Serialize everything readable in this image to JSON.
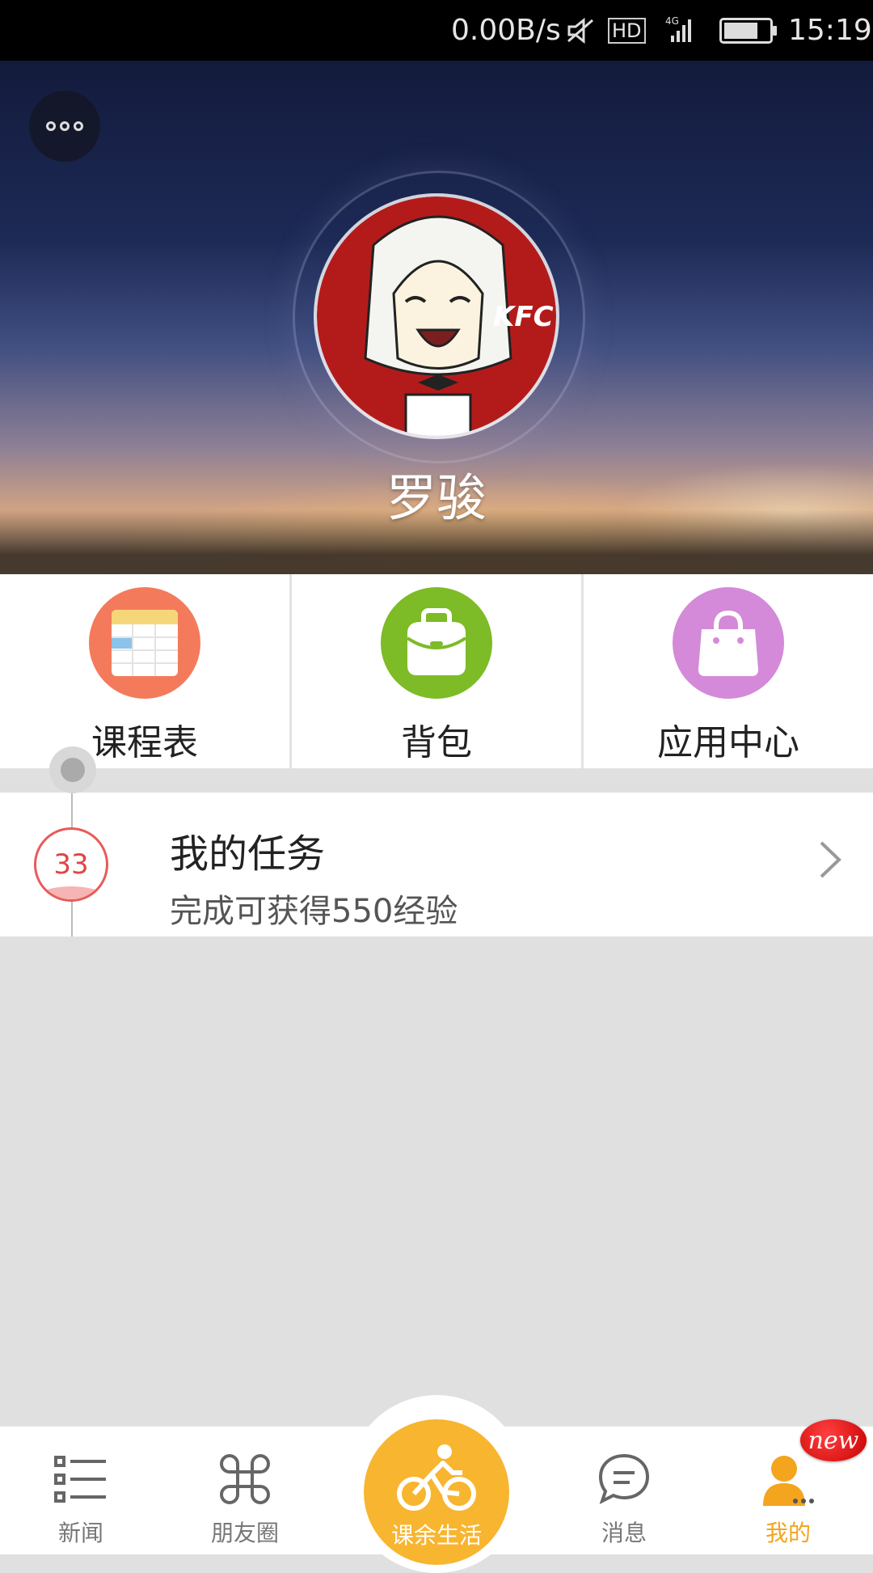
{
  "status_bar": {
    "network_speed": "0.00B/s",
    "hd_label": "HD",
    "network_type": "4G",
    "time": "15:19"
  },
  "profile": {
    "name": "罗骏",
    "avatar_text": "KFC"
  },
  "quick_menu": [
    {
      "label": "课程表",
      "color": "#f47a5c",
      "icon": "calendar-icon"
    },
    {
      "label": "背包",
      "color": "#7dbb27",
      "icon": "backpack-icon"
    },
    {
      "label": "应用中心",
      "color": "#d48ad8",
      "icon": "shopping-bag-icon"
    }
  ],
  "task": {
    "level": "33",
    "title": "我的任务",
    "subtitle": "完成可获得550经验"
  },
  "bottom_nav": {
    "items": [
      {
        "label": "新闻",
        "icon": "list-icon"
      },
      {
        "label": "朋友圈",
        "icon": "command-icon"
      },
      {
        "label": "课余生活",
        "icon": "bicycle-icon"
      },
      {
        "label": "消息",
        "icon": "chat-bubble-icon"
      },
      {
        "label": "我的",
        "icon": "user-icon"
      }
    ],
    "active_index": 4,
    "new_badge": "new",
    "accent_color": "#f3a51e"
  }
}
